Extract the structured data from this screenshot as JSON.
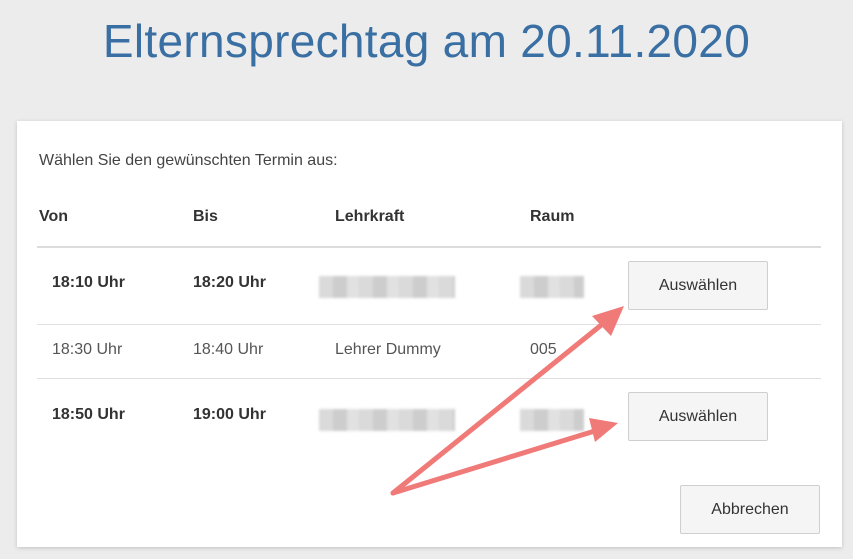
{
  "page": {
    "title": "Elternsprechtag am 20.11.2020"
  },
  "dialog": {
    "instruction": "Wählen Sie den gewünschten Termin aus:",
    "columns": {
      "from": "Von",
      "to": "Bis",
      "teacher": "Lehrkraft",
      "room": "Raum"
    },
    "rows": [
      {
        "from": "18:10 Uhr",
        "to": "18:20 Uhr",
        "teacher": "",
        "room": "",
        "button": "Auswählen",
        "available": true
      },
      {
        "from": "18:30 Uhr",
        "to": "18:40 Uhr",
        "teacher": "Lehrer Dummy",
        "room": "005",
        "button": "",
        "available": false
      },
      {
        "from": "18:50 Uhr",
        "to": "19:00 Uhr",
        "teacher": "",
        "room": "",
        "button": "Auswählen",
        "available": true
      }
    ],
    "cancel_label": "Abbrechen"
  },
  "annotation": {
    "arrow_color": "#f07a78"
  }
}
